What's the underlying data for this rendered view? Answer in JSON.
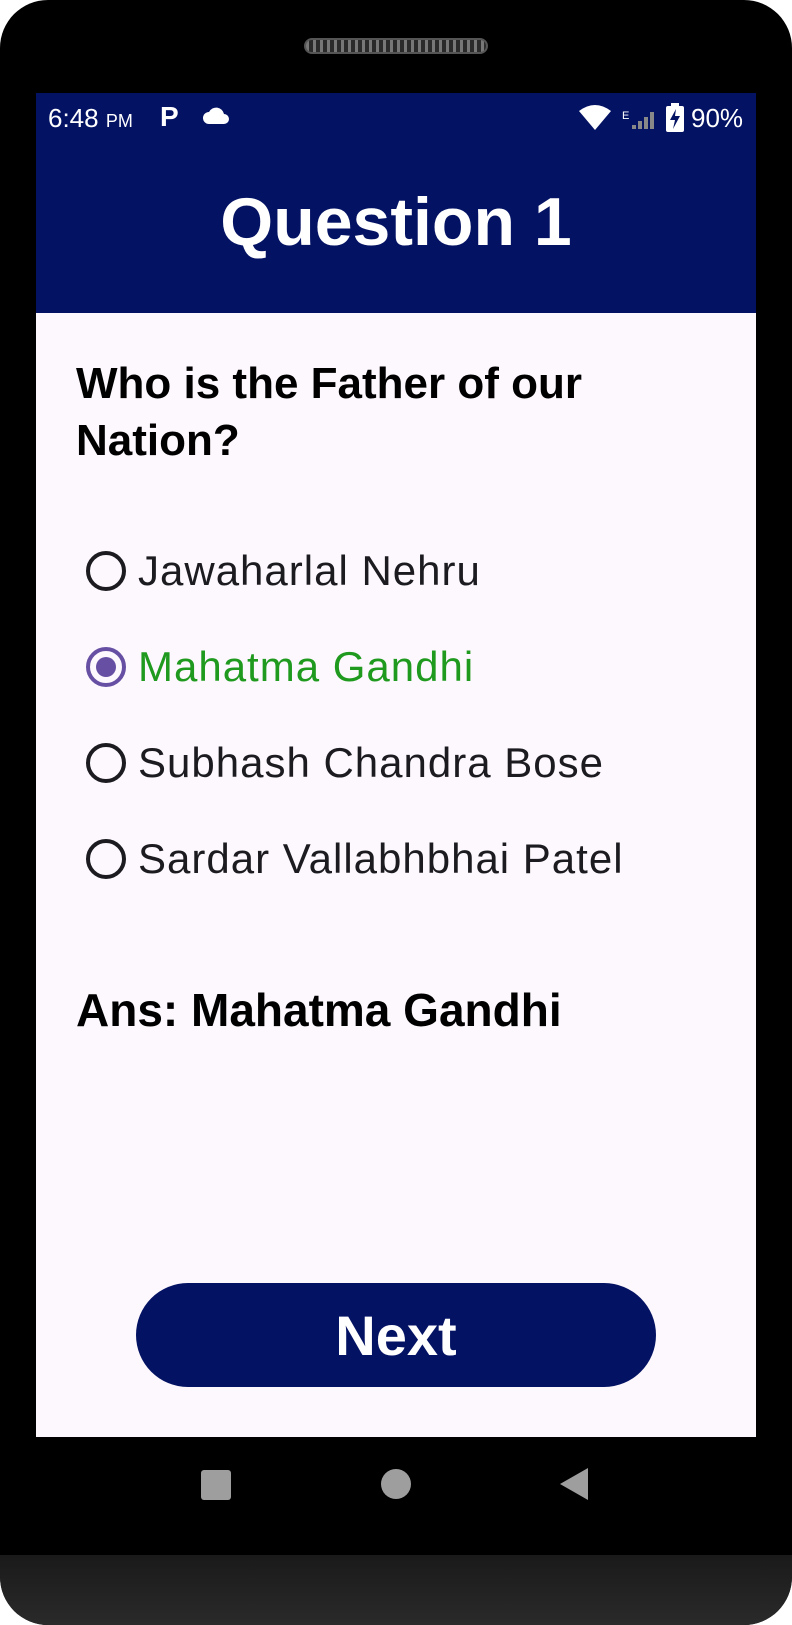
{
  "status_bar": {
    "time": "6:48",
    "time_suffix": "PM",
    "notification_p": "P",
    "signal_label": "E",
    "battery_percent": "90%"
  },
  "app_bar": {
    "title": "Question 1"
  },
  "quiz": {
    "question": "Who is the Father of our Nation?",
    "options": [
      {
        "label": "Jawaharlal Nehru",
        "selected": false
      },
      {
        "label": "Mahatma Gandhi",
        "selected": true
      },
      {
        "label": "Subhash Chandra Bose",
        "selected": false
      },
      {
        "label": "Sardar Vallabhbhai Patel",
        "selected": false
      }
    ],
    "answer": "Ans: Mahatma Gandhi",
    "next_label": "Next"
  },
  "colors": {
    "primary": "#041263",
    "radio_accent": "#6750a4",
    "selected_text": "#1f9a1f"
  },
  "icons": {
    "status": [
      "p-notification-icon",
      "cloud-icon",
      "wifi-icon",
      "signal-icon",
      "battery-charging-icon"
    ],
    "nav": [
      "recent-apps-icon",
      "home-icon",
      "back-icon"
    ]
  }
}
